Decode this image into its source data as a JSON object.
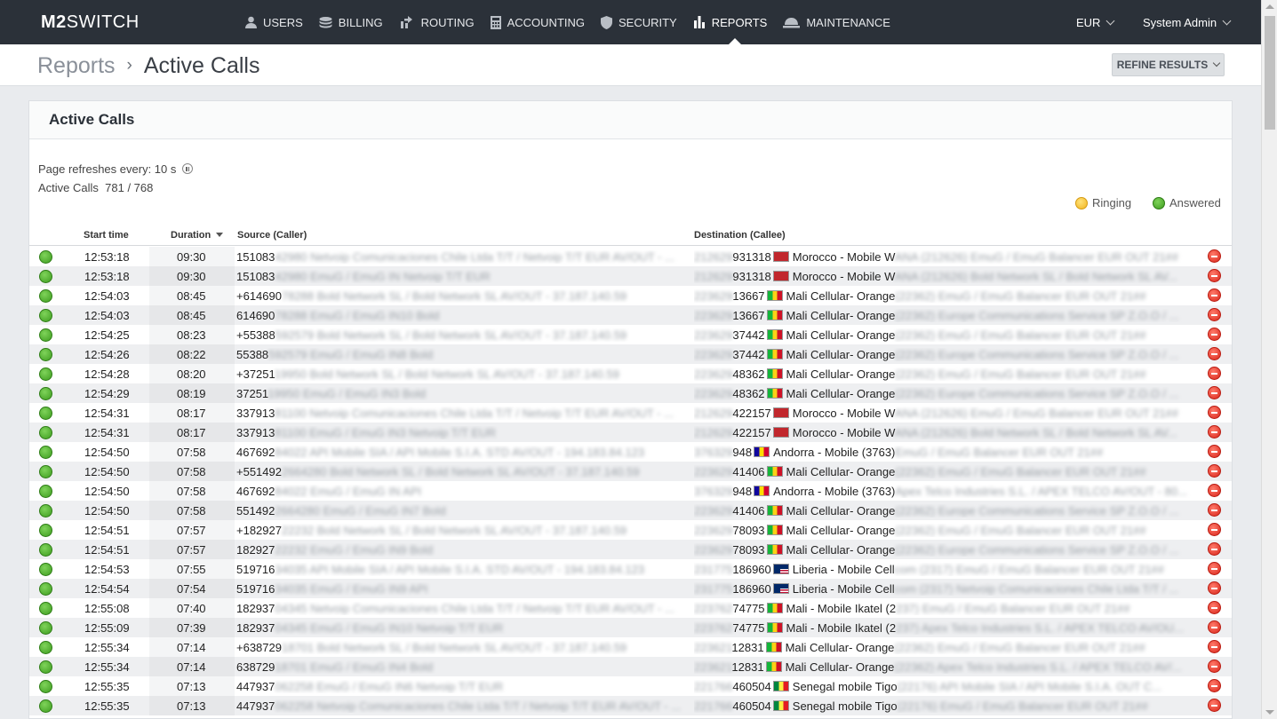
{
  "app": {
    "logo_bold": "M2",
    "logo_rest": "SWITCH"
  },
  "nav": [
    {
      "label": "USERS",
      "icon": "user-icon"
    },
    {
      "label": "BILLING",
      "icon": "coins-icon"
    },
    {
      "label": "ROUTING",
      "icon": "routing-icon"
    },
    {
      "label": "ACCOUNTING",
      "icon": "calculator-icon"
    },
    {
      "label": "SECURITY",
      "icon": "shield-icon"
    },
    {
      "label": "REPORTS",
      "icon": "bar-chart-icon",
      "active": true
    },
    {
      "label": "MAINTENANCE",
      "icon": "helmet-icon"
    }
  ],
  "currency": "EUR",
  "user": "System Admin",
  "breadcrumb": {
    "parent": "Reports",
    "separator": "›",
    "current": "Active Calls"
  },
  "refine_label": "REFINE RESULTS",
  "panel": {
    "title": "Active Calls",
    "refresh_label": "Page refreshes every: 10 s",
    "active_calls_label": "Active Calls",
    "active_calls_value": "781 / 768"
  },
  "legend": {
    "ringing": "Ringing",
    "answered": "Answered",
    "ringing_color": "#f2b51f",
    "answered_color": "#3e9d1f"
  },
  "columns": {
    "start": "Start time",
    "duration": "Duration",
    "source": "Source (Caller)",
    "destination": "Destination (Callee)"
  },
  "rows": [
    {
      "start": "12:53:18",
      "dur": "09:30",
      "src": "151083",
      "src_b": "42980 Netvoip Comunicaciones Chile Ltda T/T / Netvoip T/T EUR AV/OUT - ...",
      "dst_b": "212629",
      "dst": "931318",
      "flag": "ma",
      "dest": "Morocco - Mobile W",
      "dest_b": "ANA (212626) EmuG / EmuG Balancer EUR OUT 21##"
    },
    {
      "start": "12:53:18",
      "dur": "09:30",
      "src": "151083",
      "src_b": "42980 EmuG / EmuG IN Netvoip T/T EUR",
      "dst_b": "212629",
      "dst": "931318",
      "flag": "ma",
      "dest": "Morocco - Mobile W",
      "dest_b": "ANA (212626) Bold Network SL / Bold Network SL AV..."
    },
    {
      "start": "12:54:03",
      "dur": "08:45",
      "src": "+614690",
      "src_b": "78288 Bold Network SL / Bold Network SL AV/OUT - 37.187.140.59",
      "dst_b": "223629",
      "dst": "13667",
      "flag": "ml",
      "dest": "Mali Cellular- Orange",
      "dest_b": "(22362) EmuG / EmuG Balancer EUR OUT 21##"
    },
    {
      "start": "12:54:03",
      "dur": "08:45",
      "src": "614690",
      "src_b": "78288 EmuG / EmuG IN10 Bold",
      "dst_b": "223629",
      "dst": "13667",
      "flag": "ml",
      "dest": "Mali Cellular- Orange",
      "dest_b": "(22362) Europe Communications Service SP Z.O.O / ..."
    },
    {
      "start": "12:54:25",
      "dur": "08:23",
      "src": "+55388",
      "src_b": "592579 Bold Network SL / Bold Network SL AV/OUT - 37.187.140.59",
      "dst_b": "223629",
      "dst": "37442",
      "flag": "ml",
      "dest": "Mali Cellular- Orange",
      "dest_b": "(22362) EmuG / EmuG Balancer EUR OUT 21##"
    },
    {
      "start": "12:54:26",
      "dur": "08:22",
      "src": "55388",
      "src_b": "592579 EmuG / EmuG IN8 Bold",
      "dst_b": "223629",
      "dst": "37442",
      "flag": "ml",
      "dest": "Mali Cellular- Orange",
      "dest_b": "(22362) Europe Communications Service SP Z.O.O / ..."
    },
    {
      "start": "12:54:28",
      "dur": "08:20",
      "src": "+37251",
      "src_b": "19950 Bold Network SL / Bold Network SL AV/OUT - 37.187.140.59",
      "dst_b": "223629",
      "dst": "48362",
      "flag": "ml",
      "dest": "Mali Cellular- Orange",
      "dest_b": "(22362) EmuG / EmuG Balancer EUR OUT 21##"
    },
    {
      "start": "12:54:29",
      "dur": "08:19",
      "src": "37251",
      "src_b": "19950 EmuG / EmuG IN3 Bold",
      "dst_b": "223629",
      "dst": "48362",
      "flag": "ml",
      "dest": "Mali Cellular- Orange",
      "dest_b": "(22362) Europe Communications Service SP Z.O.O / ..."
    },
    {
      "start": "12:54:31",
      "dur": "08:17",
      "src": "337913",
      "src_b": "81100 Netvoip Comunicaciones Chile Ltda T/T / Netvoip T/T EUR AV/OUT - ...",
      "dst_b": "212629",
      "dst": "422157",
      "flag": "ma",
      "dest": "Morocco - Mobile W",
      "dest_b": "ANA (212626) EmuG / EmuG Balancer EUR OUT 21##"
    },
    {
      "start": "12:54:31",
      "dur": "08:17",
      "src": "337913",
      "src_b": "81100 EmuG / EmuG IN3 Netvoip T/T EUR",
      "dst_b": "212629",
      "dst": "422157",
      "flag": "ma",
      "dest": "Morocco - Mobile W",
      "dest_b": "ANA (212626) Bold Network SL / Bold Network SL AV..."
    },
    {
      "start": "12:54:50",
      "dur": "07:58",
      "src": "467692",
      "src_b": "84022 API Mobile SIA / API Mobile S.I.A. STD AV/OUT - 194.183.84.123",
      "dst_b": "376329",
      "dst": "948",
      "flag": "ad",
      "dest": "Andorra - Mobile (3763)",
      "dest_b": "EmuG / EmuG Balancer EUR OUT 21##"
    },
    {
      "start": "12:54:50",
      "dur": "07:58",
      "src": "+551492",
      "src_b": "2664280 Bold Network SL / Bold Network SL AV/OUT - 37.187.140.59",
      "dst_b": "223629",
      "dst": "41406",
      "flag": "ml",
      "dest": "Mali Cellular- Orange",
      "dest_b": "(22362) EmuG / EmuG Balancer EUR OUT 21##"
    },
    {
      "start": "12:54:50",
      "dur": "07:58",
      "src": "467692",
      "src_b": "84022 EmuG / EmuG IN API",
      "dst_b": "376329",
      "dst": "948",
      "flag": "ad",
      "dest": "Andorra - Mobile (3763)",
      "dest_b": "Apex Telco Industries S.L. / APEX TELCO AV/OUT - 80..."
    },
    {
      "start": "12:54:50",
      "dur": "07:58",
      "src": "551492",
      "src_b": "2664280 EmuG / EmuG IN7 Bold",
      "dst_b": "223629",
      "dst": "41406",
      "flag": "ml",
      "dest": "Mali Cellular- Orange",
      "dest_b": "(22362) Europe Communications Service SP Z.O.O / ..."
    },
    {
      "start": "12:54:51",
      "dur": "07:57",
      "src": "+182927",
      "src_b": "22232 Bold Network SL / Bold Network SL AV/OUT - 37.187.140.59",
      "dst_b": "223629",
      "dst": "78093",
      "flag": "ml",
      "dest": "Mali Cellular- Orange",
      "dest_b": "(22362) EmuG / EmuG Balancer EUR OUT 21##"
    },
    {
      "start": "12:54:51",
      "dur": "07:57",
      "src": "182927",
      "src_b": "22232 EmuG / EmuG IN9 Bold",
      "dst_b": "223629",
      "dst": "78093",
      "flag": "ml",
      "dest": "Mali Cellular- Orange",
      "dest_b": "(22362) Europe Communications Service SP Z.O.O / ..."
    },
    {
      "start": "12:54:53",
      "dur": "07:55",
      "src": "519716",
      "src_b": "34035 API Mobile SIA / API Mobile S.I.A. STD AV/OUT - 194.183.84.123",
      "dst_b": "231775",
      "dst": "186960",
      "flag": "lr",
      "dest": "Liberia - Mobile Cell",
      "dest_b": "com (2317) EmuG / EmuG Balancer EUR OUT 21##"
    },
    {
      "start": "12:54:54",
      "dur": "07:54",
      "src": "519716",
      "src_b": "34035 EmuG / EmuG IN9 API",
      "dst_b": "231775",
      "dst": "186960",
      "flag": "lr",
      "dest": "Liberia - Mobile Cell",
      "dest_b": "com (2317) Netvoip Comunicaciones Chile Ltda T/T / ..."
    },
    {
      "start": "12:55:08",
      "dur": "07:40",
      "src": "182937",
      "src_b": "04345 Netvoip Comunicaciones Chile Ltda T/T / Netvoip T/T EUR AV/OUT - ...",
      "dst_b": "223762",
      "dst": "74775",
      "flag": "ml",
      "dest": "Mali - Mobile Ikatel (2",
      "dest_b": "237) EmuG / EmuG Balancer EUR OUT 21##"
    },
    {
      "start": "12:55:09",
      "dur": "07:39",
      "src": "182937",
      "src_b": "04345 EmuG / EmuG IN10 Netvoip T/T EUR",
      "dst_b": "223762",
      "dst": "74775",
      "flag": "ml",
      "dest": "Mali - Mobile Ikatel (2",
      "dest_b": "237) Apex Telco Industries S.L. / APEX TELCO AV/OU..."
    },
    {
      "start": "12:55:34",
      "dur": "07:14",
      "src": "+638729",
      "src_b": "18701 Bold Network SL / Bold Network SL AV/OUT - 37.187.140.59",
      "dst_b": "223621",
      "dst": "12831",
      "flag": "ml",
      "dest": "Mali Cellular- Orange",
      "dest_b": "(22362) EmuG / EmuG Balancer EUR OUT 21##"
    },
    {
      "start": "12:55:34",
      "dur": "07:14",
      "src": "638729",
      "src_b": "18701 EmuG / EmuG IN4 Bold",
      "dst_b": "223621",
      "dst": "12831",
      "flag": "ml",
      "dest": "Mali Cellular- Orange",
      "dest_b": "(22362) Apex Telco Industries S.L. / APEX TELCO AV/..."
    },
    {
      "start": "12:55:35",
      "dur": "07:13",
      "src": "447937",
      "src_b": "062258 EmuG / EmuG IN6 Netvoip T/T EUR",
      "dst_b": "221766",
      "dst": "460504",
      "flag": "sn",
      "dest": "Senegal mobile Tigo",
      "dest_b": "(22176) API Mobile SIA / API Mobile S.I.A. OUT C..."
    },
    {
      "start": "12:55:35",
      "dur": "07:13",
      "src": "447937",
      "src_b": "062258 Netvoip Comunicaciones Chile Ltda T/T / Netvoip T/T EUR AV/OUT - ...",
      "dst_b": "221766",
      "dst": "460504",
      "flag": "sn",
      "dest": "Senegal mobile Tigo",
      "dest_b": "(22176) EmuG / EmuG Balancer EUR OUT 21##"
    }
  ]
}
